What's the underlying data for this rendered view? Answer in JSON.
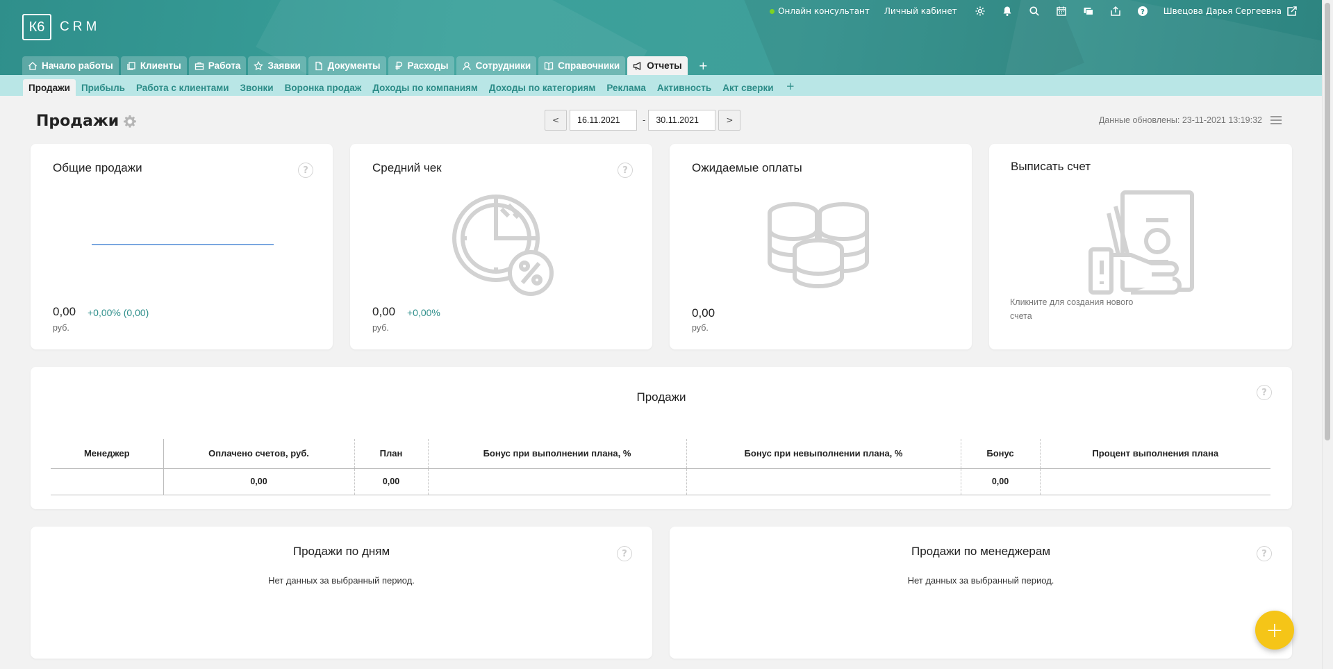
{
  "app": {
    "logo_mark": "К6",
    "logo_text": "CRM"
  },
  "topbar": {
    "online_consultant": "Онлайн консультант",
    "personal_cabinet": "Личный кабинет",
    "user_name": "Швецова Дарья Сергеевна"
  },
  "tabs": [
    {
      "label": "Начало работы",
      "icon": "home-icon"
    },
    {
      "label": "Клиенты",
      "icon": "clients-icon"
    },
    {
      "label": "Работа",
      "icon": "briefcase-icon"
    },
    {
      "label": "Заявки",
      "icon": "star-icon"
    },
    {
      "label": "Документы",
      "icon": "document-icon"
    },
    {
      "label": "Расходы",
      "icon": "ruble-icon"
    },
    {
      "label": "Сотрудники",
      "icon": "employees-icon"
    },
    {
      "label": "Справочники",
      "icon": "book-icon"
    },
    {
      "label": "Отчеты",
      "icon": "megaphone-icon",
      "active": true
    }
  ],
  "tab_add": "+",
  "subnav": [
    {
      "label": "Продажи",
      "active": true
    },
    {
      "label": "Прибыль"
    },
    {
      "label": "Работа с клиентами"
    },
    {
      "label": "Звонки"
    },
    {
      "label": "Воронка продаж"
    },
    {
      "label": "Доходы по компаниям"
    },
    {
      "label": "Доходы по категориям"
    },
    {
      "label": "Реклама"
    },
    {
      "label": "Активность"
    },
    {
      "label": "Акт сверки"
    }
  ],
  "subnav_add": "+",
  "page": {
    "title": "Продажи",
    "prev": "<",
    "next": ">",
    "date_from": "16.11.2021",
    "date_sep": "-",
    "date_to": "30.11.2021",
    "updated": "Данные обновлены: 23-11-2021 13:19:32"
  },
  "cards": {
    "total_sales": {
      "title": "Общие продажи",
      "value": "0,00",
      "delta": "+0,00% (0,00)",
      "unit": "руб."
    },
    "avg_check": {
      "title": "Средний чек",
      "value": "0,00",
      "delta": "+0,00%",
      "unit": "руб."
    },
    "expected": {
      "title": "Ожидаемые оплаты",
      "value": "0,00",
      "unit": "руб."
    },
    "invoice": {
      "title": "Выписать счет",
      "hint": "Кликните для создания нового счета"
    }
  },
  "sales_table": {
    "title": "Продажи",
    "headers": [
      "Менеджер",
      "Оплачено счетов, руб.",
      "План",
      "Бонус при выполнении плана, %",
      "Бонус при невыполнении плана, %",
      "Бонус",
      "Процент выполнения плана"
    ],
    "rows": [
      [
        "",
        "0,00",
        "0,00",
        "",
        "",
        "0,00",
        ""
      ]
    ]
  },
  "by_days": {
    "title": "Продажи по дням",
    "empty": "Нет данных за выбранный период."
  },
  "by_managers": {
    "title": "Продажи по менеджерам",
    "empty": "Нет данных за выбранный период."
  },
  "help_symbol": "?",
  "fab_symbol": "+",
  "colors": {
    "accent": "#2f8f8b",
    "subnav_bg": "#b9e6e6",
    "fab": "#f5c518",
    "online": "#7ed321"
  }
}
